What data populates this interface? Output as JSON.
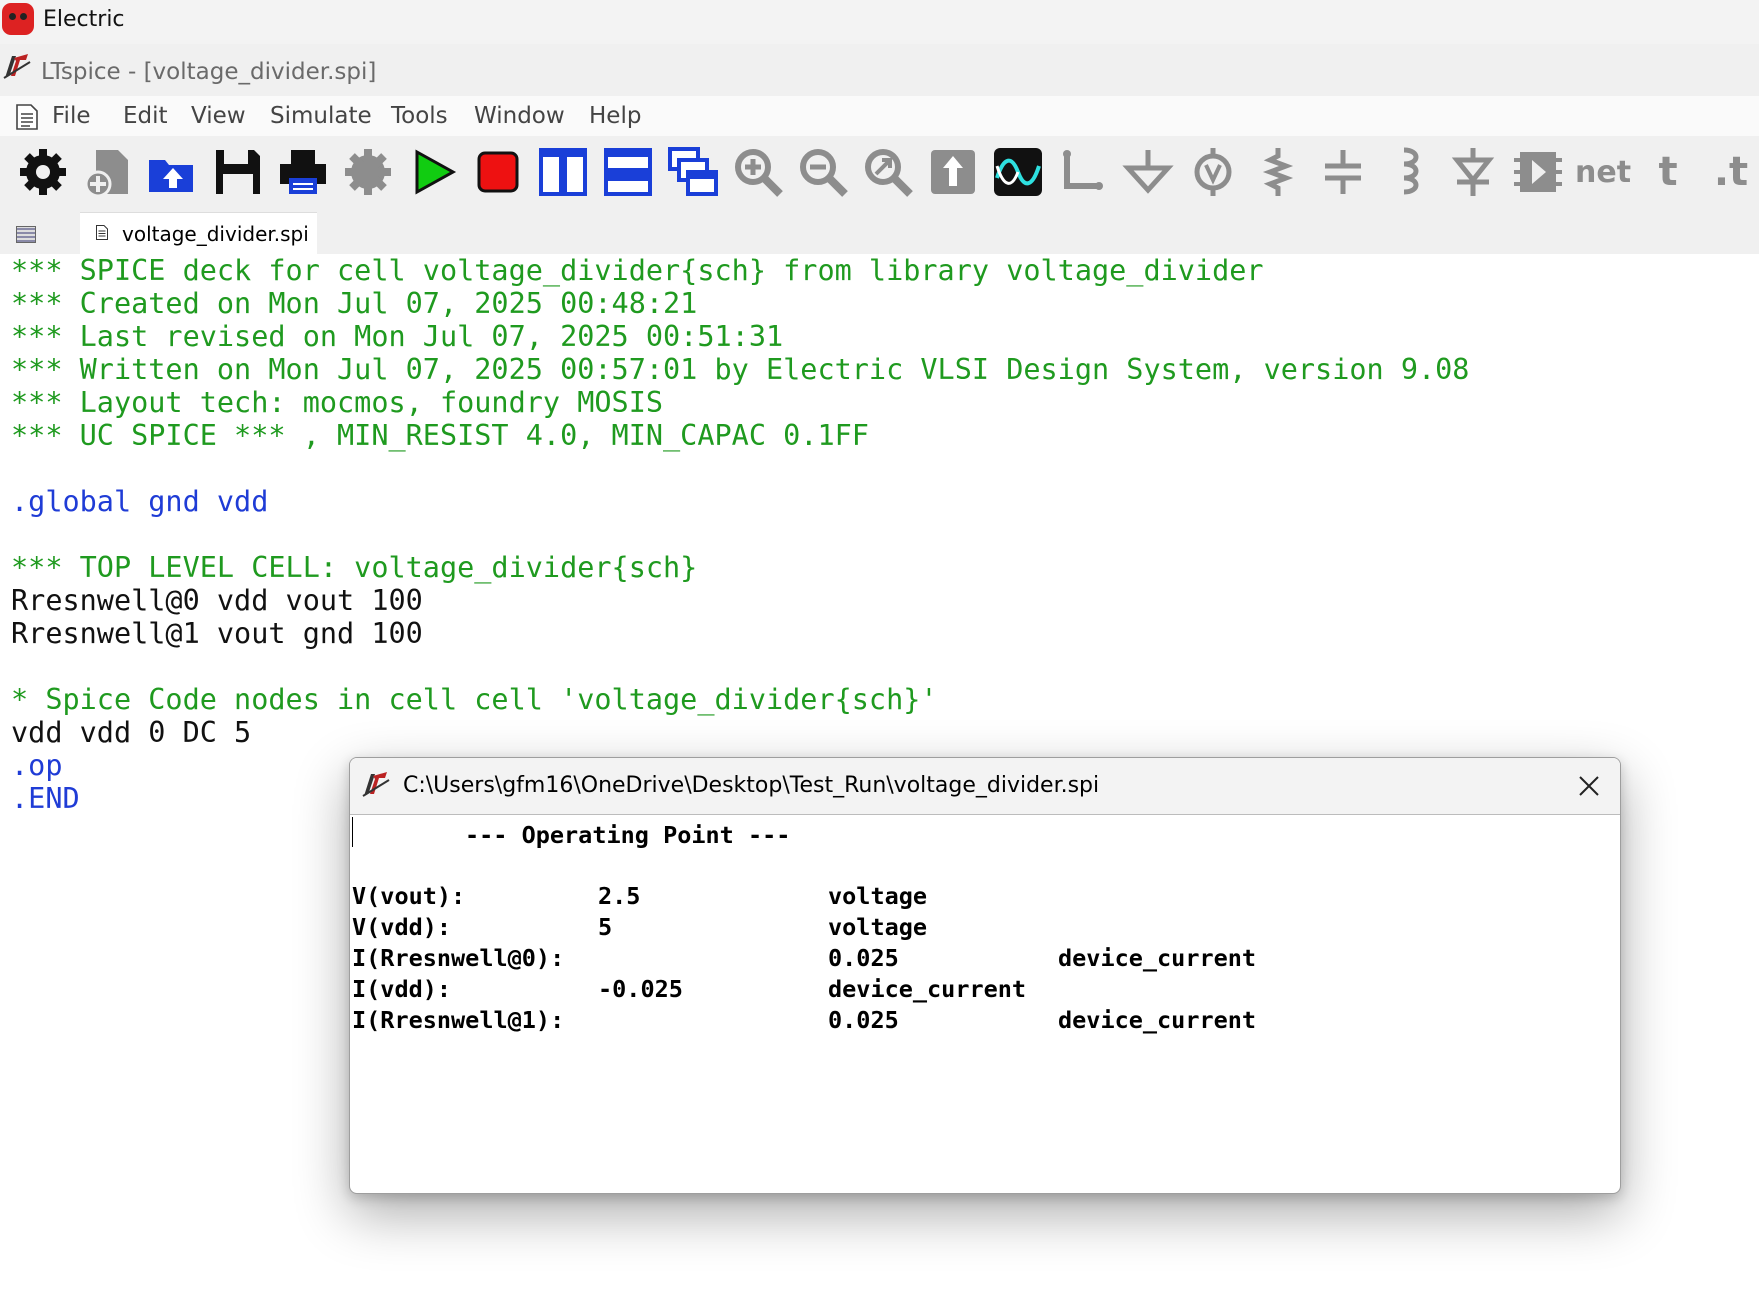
{
  "host": {
    "title": "Electric"
  },
  "app": {
    "title": "LTspice - [voltage_divider.spi]"
  },
  "menu": {
    "items": [
      "File",
      "Edit",
      "View",
      "Simulate",
      "Tools",
      "Window",
      "Help"
    ]
  },
  "toolbar": {
    "icons": [
      "settings-icon",
      "new-file-icon",
      "open-file-icon",
      "save-icon",
      "print-icon",
      "gear-disabled-icon",
      "run-icon",
      "stop-icon",
      "tile-vertical-icon",
      "tile-horizontal-icon",
      "cascade-windows-icon",
      "zoom-in-icon",
      "zoom-out-icon",
      "zoom-fit-icon",
      "pan-icon",
      "waveform-icon",
      "draw-wire-icon",
      "ground-icon",
      "voltage-source-icon",
      "resistor-icon",
      "capacitor-icon",
      "inductor-icon",
      "diode-icon",
      "component-icon",
      "net-label-icon",
      "text-icon",
      "spice-directive-icon"
    ],
    "net_label": "net",
    "text_label": "t",
    "directive_label": ".t"
  },
  "tabs": [
    {
      "label": "voltage_divider.spi"
    }
  ],
  "editor": {
    "lines": [
      {
        "text": "*** SPICE deck for cell voltage_divider{sch} from library voltage_divider",
        "kind": "comment"
      },
      {
        "text": "*** Created on Mon Jul 07, 2025 00:48:21",
        "kind": "comment"
      },
      {
        "text": "*** Last revised on Mon Jul 07, 2025 00:51:31",
        "kind": "comment"
      },
      {
        "text": "*** Written on Mon Jul 07, 2025 00:57:01 by Electric VLSI Design System, version 9.08",
        "kind": "comment"
      },
      {
        "text": "*** Layout tech: mocmos, foundry MOSIS",
        "kind": "comment"
      },
      {
        "text": "*** UC SPICE *** , MIN_RESIST 4.0, MIN_CAPAC 0.1FF",
        "kind": "comment"
      },
      {
        "text": "",
        "kind": "blank"
      },
      {
        "text": ".global gnd vdd",
        "kind": "directive"
      },
      {
        "text": "",
        "kind": "blank"
      },
      {
        "text": "*** TOP LEVEL CELL: voltage_divider{sch}",
        "kind": "comment"
      },
      {
        "text": "Rresnwell@0 vdd vout 100",
        "kind": "netlist"
      },
      {
        "text": "Rresnwell@1 vout gnd 100",
        "kind": "netlist"
      },
      {
        "text": "",
        "kind": "blank"
      },
      {
        "text": "* Spice Code nodes in cell cell 'voltage_divider{sch}'",
        "kind": "comment"
      },
      {
        "text": "vdd vdd 0 DC 5",
        "kind": "netlist"
      },
      {
        "text": ".op",
        "kind": "directive"
      },
      {
        "text": ".END",
        "kind": "directive"
      }
    ]
  },
  "colors": {
    "comment": "#1f9a1f",
    "directive": "#1f3cd6",
    "netlist": "#111111",
    "run": "#11cc11",
    "stop": "#ee1111",
    "toolbar_blue": "#1a3fd8"
  },
  "dialog": {
    "title": "C:\\Users\\gfm16\\OneDrive\\Desktop\\Test_Run\\voltage_divider.spi",
    "header": "--- Operating Point ---",
    "rows": [
      {
        "name": "V(vout):",
        "value": "2.5",
        "type": "voltage",
        "extra": ""
      },
      {
        "name": "V(vdd):",
        "value": "5",
        "type": "voltage",
        "extra": ""
      },
      {
        "name": "I(Rresnwell@0):",
        "value": "",
        "type": "0.025",
        "extra": "device_current"
      },
      {
        "name": "I(vdd):",
        "value": "-0.025",
        "type": "device_current",
        "extra": ""
      },
      {
        "name": "I(Rresnwell@1):",
        "value": "",
        "type": "0.025",
        "extra": "device_current"
      }
    ]
  }
}
